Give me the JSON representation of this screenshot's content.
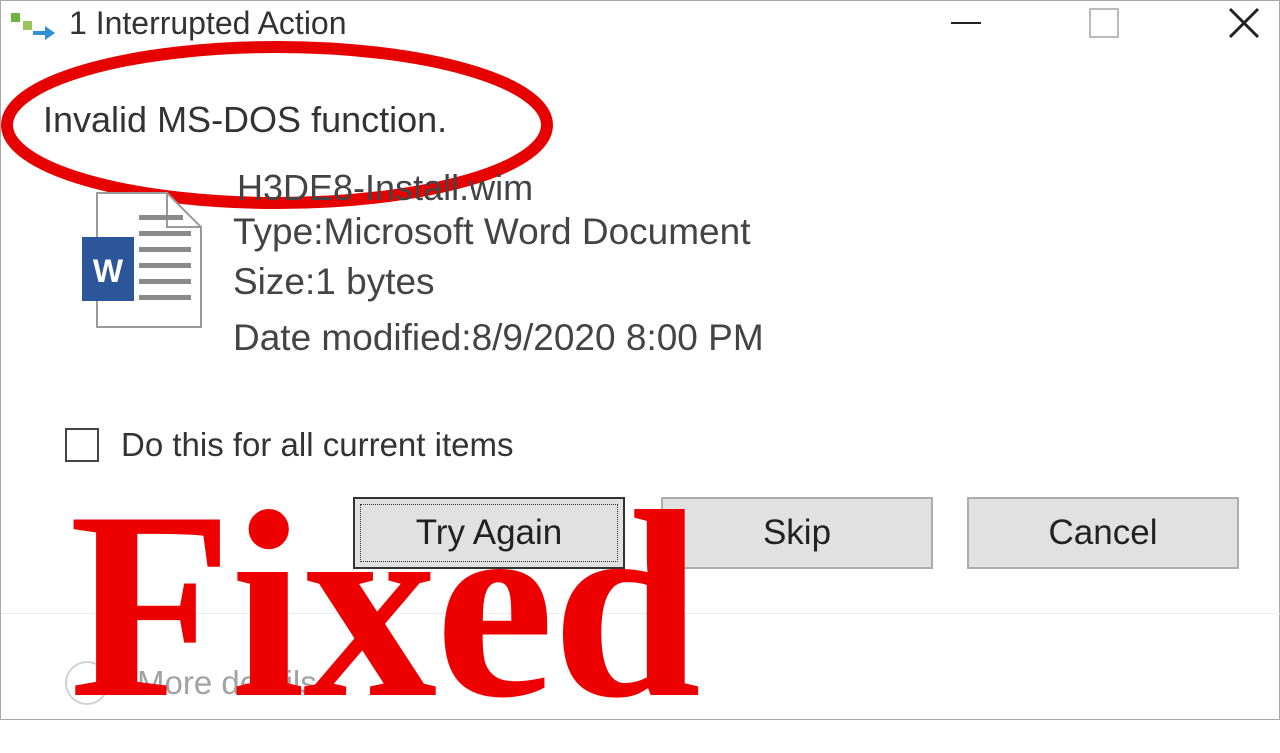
{
  "window": {
    "title": "1 Interrupted Action"
  },
  "message": {
    "error": "Invalid MS-DOS function."
  },
  "file": {
    "name": "H3DE8-Install.wim",
    "type": "Type:Microsoft Word Document",
    "size": "Size:1 bytes",
    "date_modified": "Date modified:8/9/2020 8:00 PM",
    "icon": "word-document-icon"
  },
  "options": {
    "apply_all_label": "Do this for all current items",
    "apply_all_checked": false
  },
  "buttons": {
    "try_again": "Try Again",
    "skip": "Skip",
    "cancel": "Cancel"
  },
  "footer": {
    "more_details": "More details"
  },
  "overlay": {
    "text": "Fixed",
    "color": "#ee0000"
  },
  "colors": {
    "word_blue": "#2b579a",
    "highlight_red": "#e60000",
    "button_bg": "#e1e1e1"
  }
}
